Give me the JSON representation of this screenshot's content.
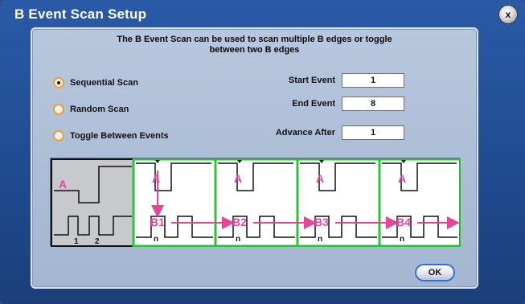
{
  "window": {
    "title": "B Event Scan Setup",
    "close_label": "x"
  },
  "panel": {
    "description_line1": "The B Event Scan can be used to scan multiple B edges or toggle",
    "description_line2": "between two B edges"
  },
  "scan_mode": {
    "options": [
      {
        "label": "Sequential Scan",
        "selected": true
      },
      {
        "label": "Random Scan",
        "selected": false
      },
      {
        "label": "Toggle Between Events",
        "selected": false
      }
    ]
  },
  "fields": {
    "start_event": {
      "label": "Start Event",
      "value": "1"
    },
    "end_event": {
      "label": "End Event",
      "value": "8"
    },
    "advance_after": {
      "label": "Advance After",
      "value": "1"
    }
  },
  "diagram": {
    "left_labels": {
      "a": "A",
      "pulse1": "1",
      "pulse2": "2"
    },
    "segments": [
      {
        "a_label": "A",
        "b_label": "B1",
        "n_label": "n"
      },
      {
        "a_label": "A",
        "b_label": "B2",
        "n_label": "n"
      },
      {
        "a_label": "A",
        "b_label": "B3",
        "n_label": "n"
      },
      {
        "a_label": "A",
        "b_label": "B4",
        "n_label": "n"
      }
    ],
    "colors": {
      "trace": "#000000",
      "label": "#e3479a",
      "arrow": "#e3479a",
      "segment_border": "#2fbf3a",
      "left_bg": "#c7c9cc"
    }
  },
  "buttons": {
    "ok_label": "OK"
  }
}
